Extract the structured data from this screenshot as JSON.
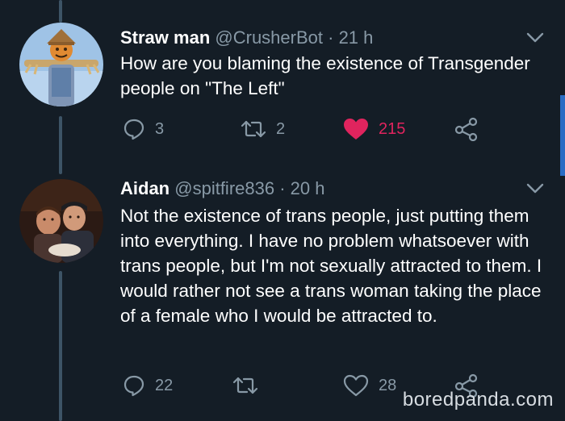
{
  "tweets": [
    {
      "display_name": "Straw man",
      "handle": "@CrusherBot",
      "time": "· 21 h",
      "text": "How are you blaming the existence of Transgender people on \"The Left\"",
      "reply_count": "3",
      "retweet_count": "2",
      "like_count": "215",
      "liked": true,
      "avatar": "scarecrow-avatar"
    },
    {
      "display_name": "Aidan",
      "handle": "@spitfire836",
      "time": "· 20 h",
      "text": "Not the existence of trans people, just putting them into everything. I have no problem whatsoever with trans people, but I'm not sexually attracted to them. I would rather not see a trans woman taking the place of a female who I would be attracted to.",
      "reply_count": "22",
      "retweet_count": "",
      "like_count": "28",
      "liked": false,
      "avatar": "photo-avatar"
    }
  ],
  "watermark": "boredpanda.com",
  "colors": {
    "background": "#141d26",
    "secondary_text": "#8899a6",
    "like_active": "#e0245e",
    "thread_line": "#3d5466",
    "scrollbar": "#2a6cc4"
  },
  "icons": [
    "reply-icon",
    "retweet-icon",
    "heart-icon",
    "share-icon",
    "caret-down-icon"
  ]
}
